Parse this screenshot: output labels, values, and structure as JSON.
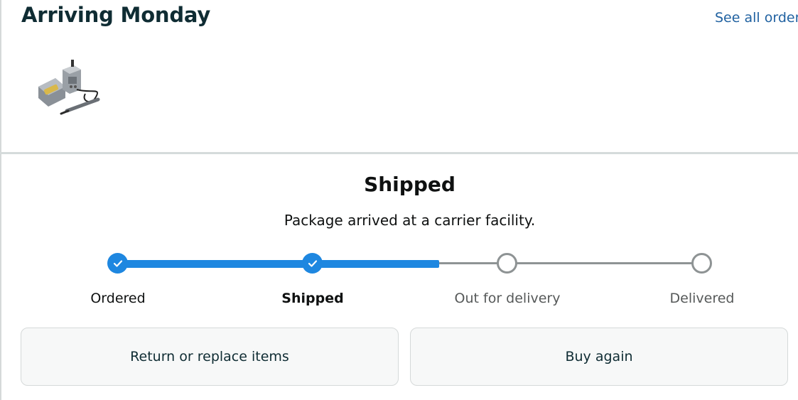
{
  "header": {
    "title": "Arriving Monday",
    "see_all_orders": "See all orders"
  },
  "product": {
    "image_icon": "soldering-station-product-image"
  },
  "status": {
    "title": "Shipped",
    "subtitle": "Package arrived at a carrier facility."
  },
  "progress": {
    "completed_fraction": 0.55,
    "steps": [
      {
        "label": "Ordered",
        "state": "done"
      },
      {
        "label": "Shipped",
        "state": "current"
      },
      {
        "label": "Out for delivery",
        "state": "future"
      },
      {
        "label": "Delivered",
        "state": "future"
      }
    ]
  },
  "actions": {
    "return_label": "Return or replace items",
    "buy_again_label": "Buy again"
  },
  "colors": {
    "accent": "#1e87e0",
    "link": "#2162a1",
    "track_gray": "#8e9394"
  }
}
